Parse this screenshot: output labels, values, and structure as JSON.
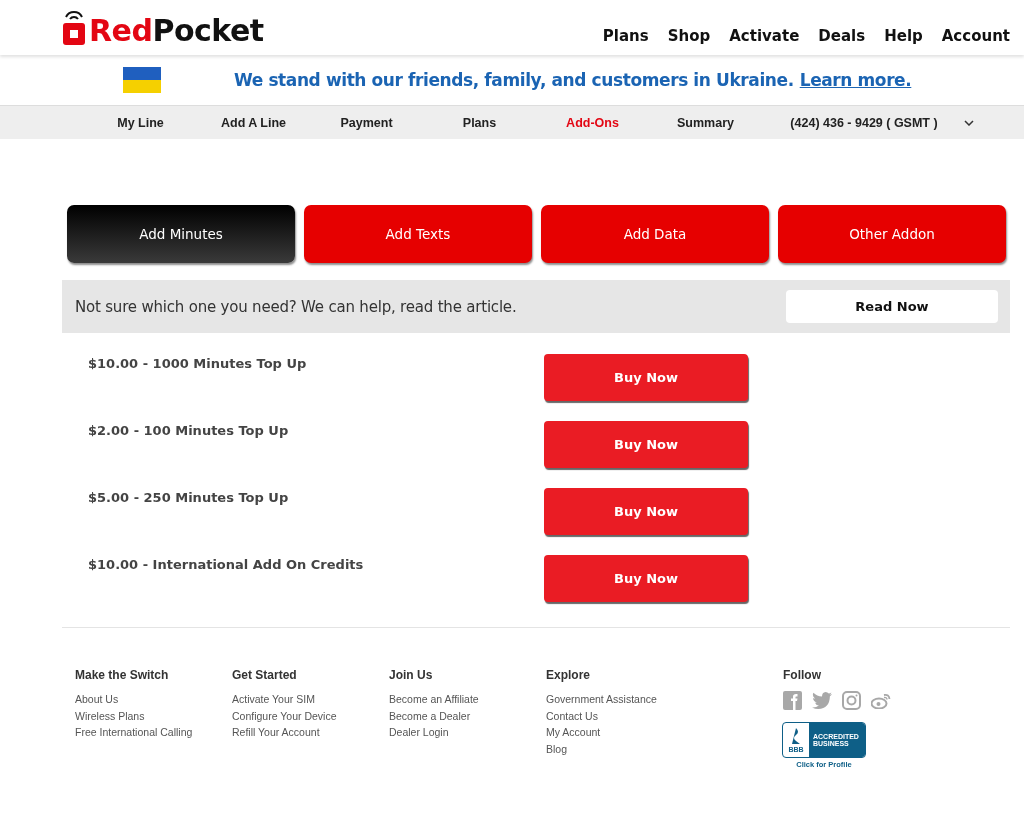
{
  "header": {
    "logo": {
      "accent": "Red",
      "rest": "Pocket"
    },
    "nav": [
      "Plans",
      "Shop",
      "Activate",
      "Deals",
      "Help",
      "Account"
    ]
  },
  "banner": {
    "text": "We stand with our friends, family, and customers in Ukraine.",
    "link": "Learn more."
  },
  "subnav": {
    "items": [
      {
        "label": "My Line",
        "selected": false
      },
      {
        "label": "Add A Line",
        "selected": false
      },
      {
        "label": "Payment",
        "selected": false
      },
      {
        "label": "Plans",
        "selected": false
      },
      {
        "label": "Add-Ons",
        "selected": true
      },
      {
        "label": "Summary",
        "selected": false
      }
    ],
    "line": "(424) 436 - 9429 ( GSMT )"
  },
  "tabs": [
    {
      "label": "Add Minutes",
      "selected": true
    },
    {
      "label": "Add Texts",
      "selected": false
    },
    {
      "label": "Add Data",
      "selected": false
    },
    {
      "label": "Other Addon",
      "selected": false
    }
  ],
  "help": {
    "text": "Not sure which one you need? We can help, read the article.",
    "button": "Read Now"
  },
  "products": [
    {
      "name": "$10.00 - 1000 Minutes Top Up",
      "button": "Buy Now"
    },
    {
      "name": "$2.00 - 100 Minutes Top Up",
      "button": "Buy Now"
    },
    {
      "name": "$5.00 - 250 Minutes Top Up",
      "button": "Buy Now"
    },
    {
      "name": "$10.00 - International Add On Credits",
      "button": "Buy Now"
    }
  ],
  "footer": {
    "columns": [
      {
        "title": "Make the Switch",
        "links": [
          "About Us",
          "Wireless Plans",
          "Free International Calling"
        ]
      },
      {
        "title": "Get Started",
        "links": [
          "Activate Your SIM",
          "Configure Your Device",
          "Refill Your Account"
        ]
      },
      {
        "title": "Join Us",
        "links": [
          "Become an Affiliate",
          "Become a Dealer",
          "Dealer Login"
        ]
      },
      {
        "title": "Explore",
        "links": [
          "Government Assistance",
          "Contact Us",
          "My Account",
          "Blog"
        ]
      }
    ],
    "follow": {
      "title": "Follow",
      "bbb": {
        "mark": "BBB",
        "lines": [
          "ACCREDITED",
          "BUSINESS"
        ],
        "caption": "Click for Profile"
      }
    }
  }
}
